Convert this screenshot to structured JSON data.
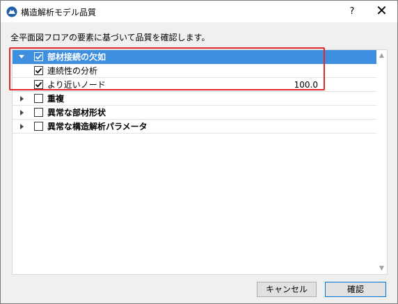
{
  "window": {
    "title": "構造解析モデル品質",
    "help_label": "?",
    "close_label": "✕"
  },
  "description": "全平面図フロアの要素に基づいて品質を確認します。",
  "tree": {
    "rows": [
      {
        "label": "部材接続の欠如",
        "checked": true,
        "expanded": true,
        "bold": true,
        "selected": true
      },
      {
        "label": "連続性の分析",
        "checked": true
      },
      {
        "label": "より近いノード",
        "checked": true,
        "value": "100.0"
      },
      {
        "label": "重複",
        "checked": false,
        "expanded": false,
        "bold": true
      },
      {
        "label": "異常な部材形状",
        "checked": false,
        "expanded": false,
        "bold": true
      },
      {
        "label": "異常な構造解析パラメータ",
        "checked": false,
        "expanded": false,
        "bold": true
      }
    ]
  },
  "buttons": {
    "cancel": "キャンセル",
    "ok": "確認"
  },
  "colors": {
    "selection": "#3f8fe0",
    "highlight_box": "#e3262b",
    "primary_border": "#0078d7"
  }
}
